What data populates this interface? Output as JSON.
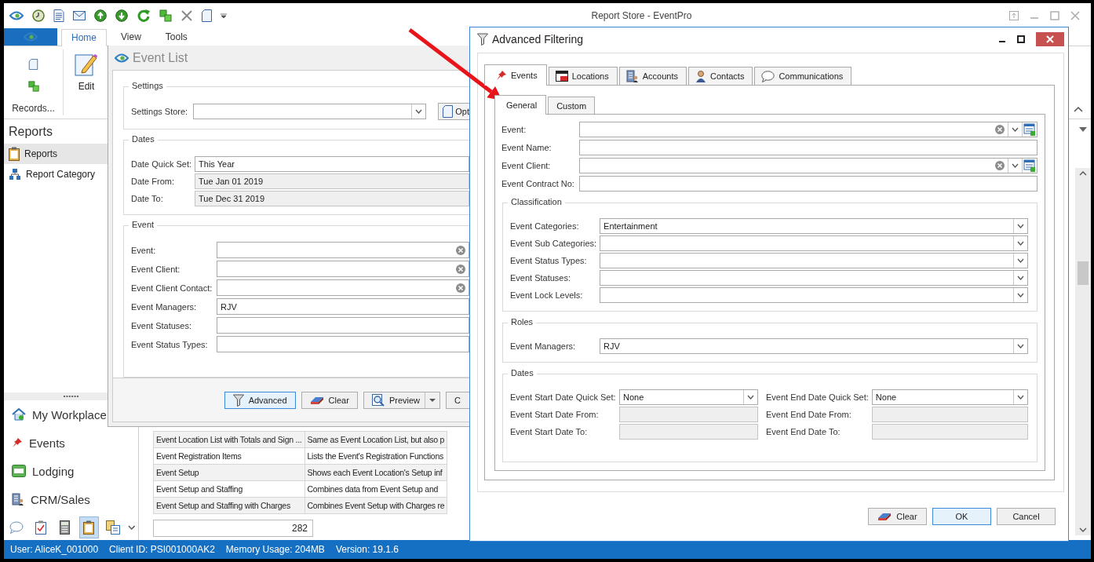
{
  "window": {
    "title": "Report Store - EventPro"
  },
  "ribbon": {
    "tabs": [
      {
        "label": "Home",
        "selected": true
      },
      {
        "label": "View",
        "selected": false
      },
      {
        "label": "Tools",
        "selected": false
      }
    ],
    "group_label": "Records...",
    "edit_button": "Edit"
  },
  "sidebar": {
    "header": "Reports",
    "items": [
      {
        "label": "Reports",
        "selected": true
      },
      {
        "label": "Report Category",
        "selected": false
      }
    ]
  },
  "nav_buttons": [
    {
      "label": "My Workplace"
    },
    {
      "label": "Events"
    },
    {
      "label": "Lodging"
    },
    {
      "label": "CRM/Sales"
    }
  ],
  "nav_shortcuts": [
    {
      "selected": false
    },
    {
      "selected": false
    },
    {
      "selected": false
    },
    {
      "selected": true
    },
    {
      "selected": false
    }
  ],
  "table": {
    "rows": [
      {
        "column_1": "Event Location List with Totals and Sign ...",
        "column_2": "Same as Event Location List, but also p"
      },
      {
        "column_1": "Event Registration Items",
        "column_2": "Lists the Event's Registration Functions"
      },
      {
        "column_1": "Event Setup",
        "column_2": "Shows each Event Location's Setup inf"
      },
      {
        "column_1": "Event Setup and Staffing",
        "column_2": "Combines data from Event Setup and"
      },
      {
        "column_1": "Event Setup and Staffing with Charges",
        "column_2": "Combines Event Setup with Charges re"
      }
    ],
    "count": "282"
  },
  "event_list": {
    "title": "Event List",
    "groups": [
      {
        "title": "Settings",
        "side_button": "Opt",
        "fields": [
          {
            "label": "Settings Store:",
            "kind": "dropdown",
            "disabled": false
          }
        ]
      },
      {
        "title": "Dates",
        "fields": [
          {
            "label": "Date Quick Set:",
            "kind": "text",
            "value": "This Year",
            "disabled": false
          },
          {
            "label": "Date From:",
            "kind": "text",
            "value": "Tue Jan 01 2019",
            "disabled": true
          },
          {
            "label": "Date To:",
            "kind": "text",
            "value": "Tue Dec 31 2019",
            "disabled": true
          }
        ]
      },
      {
        "title": "Event",
        "fields": [
          {
            "label": "Event:",
            "kind": "clearable",
            "disabled": false
          },
          {
            "label": "Event Client:",
            "kind": "clearable",
            "disabled": false
          },
          {
            "label": "Event Client Contact:",
            "kind": "clearable",
            "disabled": false
          },
          {
            "label": "Event Managers:",
            "kind": "text",
            "value": "RJV",
            "disabled": false
          },
          {
            "label": "Event Statuses:",
            "kind": "text",
            "disabled": false
          },
          {
            "label": "Event Status Types:",
            "kind": "text",
            "disabled": false
          }
        ]
      }
    ],
    "buttons": [
      {
        "label": "Advanced",
        "kind": "filter",
        "default": true
      },
      {
        "label": "Clear",
        "kind": "eraser",
        "default": false
      },
      {
        "label": "Preview",
        "kind": "preview_split",
        "default": false
      },
      {
        "label": "C",
        "kind": "plain",
        "default": false
      }
    ]
  },
  "dialog": {
    "title": "Advanced Filtering",
    "tabs": [
      {
        "label": "Events",
        "selected": true
      },
      {
        "label": "Locations",
        "selected": false
      },
      {
        "label": "Accounts",
        "selected": false
      },
      {
        "label": "Contacts",
        "selected": false
      },
      {
        "label": "Communications",
        "selected": false
      }
    ],
    "subtabs": [
      {
        "label": "General",
        "selected": true
      },
      {
        "label": "Custom",
        "selected": false
      }
    ],
    "fields": [
      {
        "label": "Event:",
        "kind": "lookup",
        "disabled": false
      },
      {
        "label": "Event Name:",
        "kind": "text",
        "disabled": false
      },
      {
        "label": "Event Client:",
        "kind": "lookup",
        "disabled": false
      },
      {
        "label": "Event Contract No:",
        "kind": "text",
        "disabled": false
      }
    ],
    "groups": [
      {
        "title": "Classification",
        "kind": "single",
        "fields": [
          {
            "label": "Event Categories:",
            "kind": "dropdown",
            "value": "Entertainment",
            "disabled": false
          },
          {
            "label": "Event Sub Categories:",
            "kind": "dropdown",
            "disabled": false
          },
          {
            "label": "Event Status Types:",
            "kind": "dropdown",
            "disabled": false
          },
          {
            "label": "Event Statuses:",
            "kind": "dropdown",
            "disabled": false
          },
          {
            "label": "Event Lock Levels:",
            "kind": "dropdown",
            "disabled": false
          }
        ]
      },
      {
        "title": "Roles",
        "kind": "single",
        "fields": [
          {
            "label": "Event Managers:",
            "kind": "dropdown",
            "value": "RJV",
            "disabled": false
          }
        ]
      },
      {
        "title": "Dates",
        "kind": "pairs",
        "fields": [
          {
            "label": "Event Start Date Quick Set:",
            "kind": "dropdown",
            "value": "None",
            "disabled": false
          },
          {
            "label": "Event End Date Quick Set:",
            "kind": "dropdown",
            "value": "None",
            "disabled": false
          },
          {
            "label": "Event Start Date From:",
            "kind": "text",
            "disabled": true
          },
          {
            "label": "Event End Date From:",
            "kind": "text",
            "disabled": true
          },
          {
            "label": "Event Start Date To:",
            "kind": "text",
            "disabled": true
          },
          {
            "label": "Event End Date To:",
            "kind": "text",
            "disabled": true
          }
        ]
      }
    ],
    "buttons": [
      {
        "label": "Clear",
        "kind": "eraser",
        "default": false
      },
      {
        "label": "OK",
        "kind": "plain",
        "default": true
      },
      {
        "label": "Cancel",
        "kind": "plain",
        "default": false
      }
    ]
  },
  "status_bar": [
    "User: AliceK_001000",
    "Client ID: PSI001000AK2",
    "Memory Usage: 204MB",
    "Version: 19.1.6"
  ]
}
